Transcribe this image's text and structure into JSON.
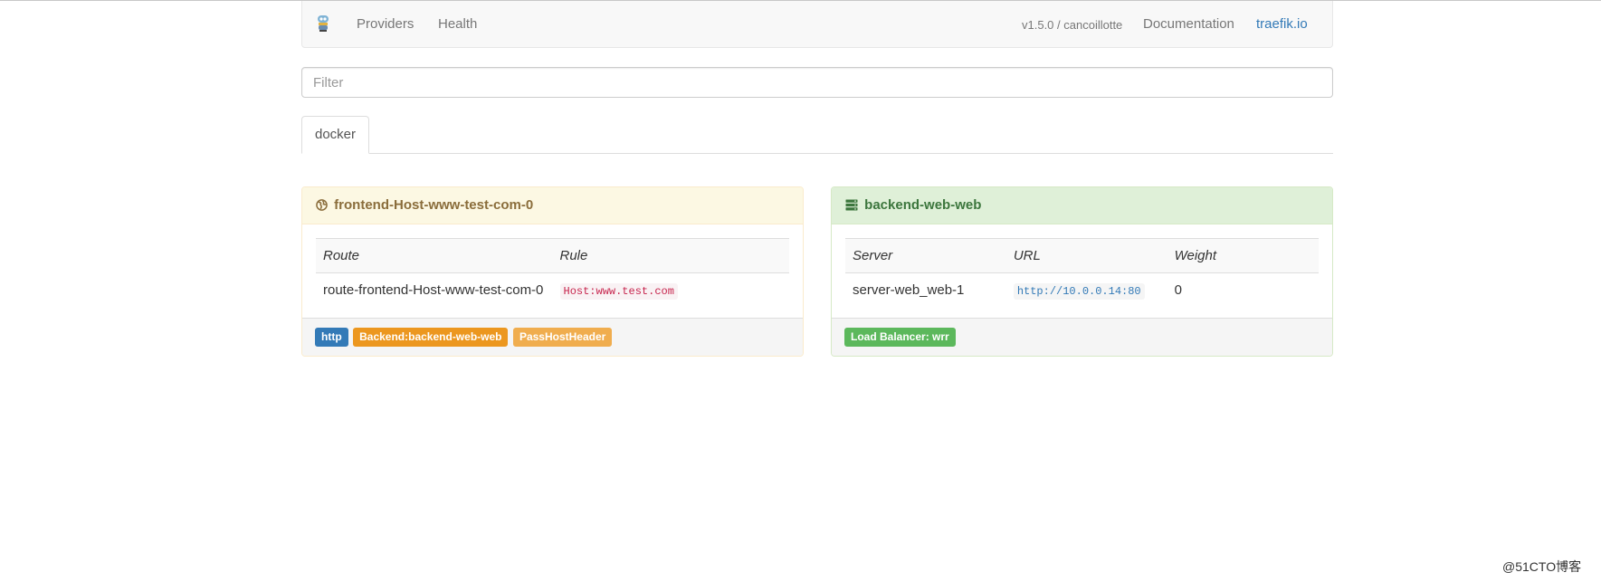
{
  "navbar": {
    "logo_icon": "traefik-gopher-icon",
    "providers": "Providers",
    "health": "Health",
    "version": "v1.5.0 / cancoillotte",
    "documentation": "Documentation",
    "site": "traefik.io",
    "site_color": "#337ab7"
  },
  "filter": {
    "placeholder": "Filter",
    "value": ""
  },
  "tabs": [
    {
      "label": "docker",
      "active": true
    }
  ],
  "frontend": {
    "icon": "globe-icon",
    "title": "frontend-Host-www-test-com-0",
    "columns": [
      "Route",
      "Rule"
    ],
    "rows": [
      {
        "route": "route-frontend-Host-www-test-com-0",
        "rule": "Host:www.test.com"
      }
    ],
    "labels": [
      {
        "text": "http",
        "color": "#337ab7"
      },
      {
        "text": "Backend:backend-web-web",
        "color": "#ec971f"
      },
      {
        "text": "PassHostHeader",
        "color": "#f0ad4e"
      }
    ]
  },
  "backend": {
    "icon": "server-stack-icon",
    "title": "backend-web-web",
    "columns": [
      "Server",
      "URL",
      "Weight"
    ],
    "rows": [
      {
        "server": "server-web_web-1",
        "url": "http://10.0.0.14:80",
        "weight": "0"
      }
    ],
    "labels": [
      {
        "text": "Load Balancer: wrr",
        "color": "#5cb85c"
      }
    ]
  },
  "watermark": "@51CTO博客"
}
